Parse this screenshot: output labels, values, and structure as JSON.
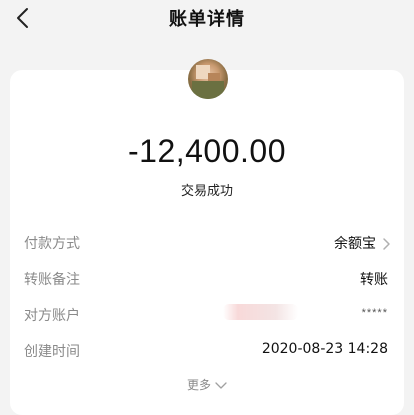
{
  "header": {
    "title": "账单详情",
    "back_icon": "chevron-left-icon"
  },
  "summary": {
    "amount": "-12,400.00",
    "status": "交易成功"
  },
  "details": {
    "payment_method": {
      "label": "付款方式",
      "value": "余额宝"
    },
    "transfer_note": {
      "label": "转账备注",
      "value": "转账"
    },
    "counterparty": {
      "label": "对方账户",
      "masked_value": "*****"
    },
    "created_time": {
      "label": "创建时间",
      "value": "2020-08-23 14:28"
    }
  },
  "more": {
    "label": "更多"
  },
  "colors": {
    "background": "#f3f3f3",
    "card": "#ffffff",
    "label": "#8a8a8a",
    "text": "#111111"
  }
}
